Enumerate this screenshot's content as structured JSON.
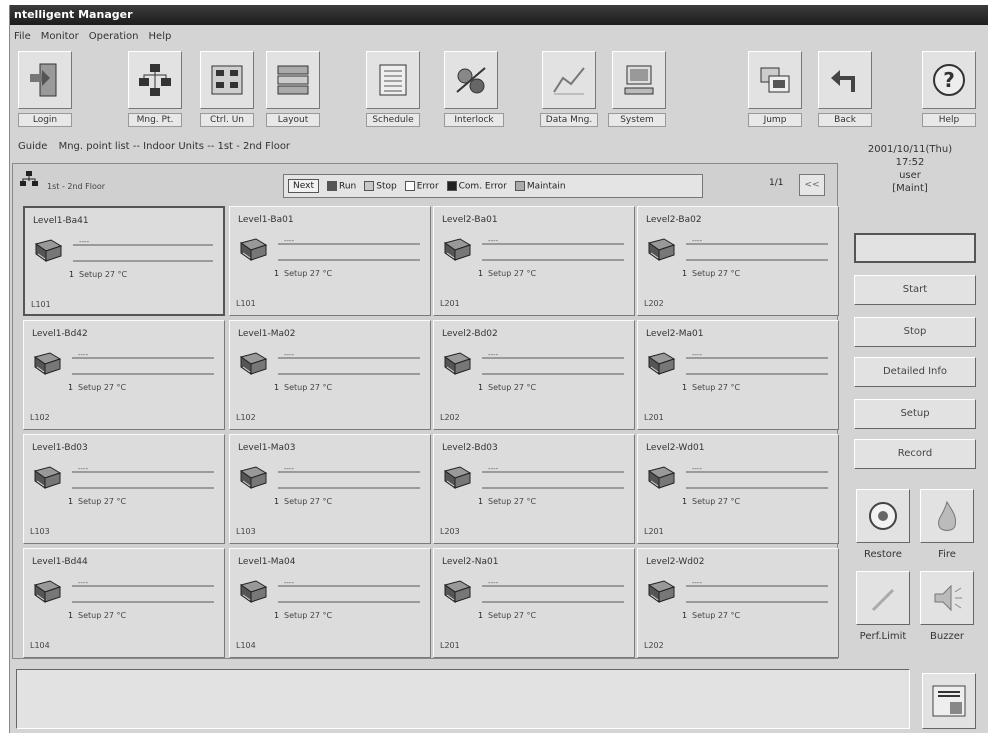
{
  "window": {
    "title": "ntelligent Manager"
  },
  "menu": [
    "File",
    "Monitor",
    "Operation",
    "Help"
  ],
  "toolbar": [
    {
      "id": "login",
      "label": "Login",
      "icon": "login-icon"
    },
    {
      "id": "mng_pt",
      "label": "Mng. Pt.",
      "icon": "network-icon"
    },
    {
      "id": "ctrl_unit",
      "label": "Ctrl. Un",
      "icon": "control-unit-icon"
    },
    {
      "id": "layout",
      "label": "Layout",
      "icon": "layout-icon"
    },
    {
      "id": "schedule",
      "label": "Schedule",
      "icon": "schedule-icon"
    },
    {
      "id": "interlock",
      "label": "Interlock",
      "icon": "interlock-icon"
    },
    {
      "id": "data_mng",
      "label": "Data Mng.",
      "icon": "data-graph-icon"
    },
    {
      "id": "system",
      "label": "System",
      "icon": "computer-icon"
    },
    {
      "id": "jump",
      "label": "Jump",
      "icon": "jump-icon"
    },
    {
      "id": "back",
      "label": "Back",
      "icon": "back-arrow-icon"
    },
    {
      "id": "help",
      "label": "Help",
      "icon": "help-icon"
    }
  ],
  "guide": {
    "label": "Guide",
    "path": "Mng. point list -- Indoor Units -- 1st - 2nd Floor"
  },
  "datetime": {
    "date": "2001/10/11(Thu)",
    "time": "17:52",
    "user_label": "user",
    "user": "[Maint]"
  },
  "panel": {
    "floor_name": "1st - 2nd Floor",
    "legend": {
      "next": "Next",
      "items": [
        {
          "label": "Run",
          "color": "#555555"
        },
        {
          "label": "Stop",
          "color": "#c8c8c8"
        },
        {
          "label": "Error",
          "color": "#ffffff"
        },
        {
          "label": "Com. Error",
          "color": "#222222"
        },
        {
          "label": "Maintain",
          "color": "#aaaaaa"
        }
      ]
    },
    "page": "1/1",
    "page_btn": "<<"
  },
  "units": [
    {
      "name": "Level1-Ba41",
      "val": "----",
      "num": "1",
      "setup": "Setup 27 °C",
      "addr": "L101"
    },
    {
      "name": "Level1-Ba01",
      "val": "----",
      "num": "1",
      "setup": "Setup 27 °C",
      "addr": "L101"
    },
    {
      "name": "Level2-Ba01",
      "val": "----",
      "num": "1",
      "setup": "Setup 27 °C",
      "addr": "L201"
    },
    {
      "name": "Level2-Ba02",
      "val": "----",
      "num": "1",
      "setup": "Setup 27 °C",
      "addr": "L202"
    },
    {
      "name": "Level1-Bd42",
      "val": "----",
      "num": "1",
      "setup": "Setup 27 °C",
      "addr": "L102"
    },
    {
      "name": "Level1-Ma02",
      "val": "----",
      "num": "1",
      "setup": "Setup 27 °C",
      "addr": "L102"
    },
    {
      "name": "Level2-Bd02",
      "val": "----",
      "num": "1",
      "setup": "Setup 27 °C",
      "addr": "L202"
    },
    {
      "name": "Level2-Ma01",
      "val": "----",
      "num": "1",
      "setup": "Setup 27 °C",
      "addr": "L201"
    },
    {
      "name": "Level1-Bd03",
      "val": "----",
      "num": "1",
      "setup": "Setup 27 °C",
      "addr": "L103"
    },
    {
      "name": "Level1-Ma03",
      "val": "----",
      "num": "1",
      "setup": "Setup 27 °C",
      "addr": "L103"
    },
    {
      "name": "Level2-Bd03",
      "val": "----",
      "num": "1",
      "setup": "Setup 27 °C",
      "addr": "L203"
    },
    {
      "name": "Level2-Wd01",
      "val": "----",
      "num": "1",
      "setup": "Setup 27 °C",
      "addr": "L201"
    },
    {
      "name": "Level1-Bd44",
      "val": "----",
      "num": "1",
      "setup": "Setup 27 °C",
      "addr": "L104"
    },
    {
      "name": "Level1-Ma04",
      "val": "----",
      "num": "1",
      "setup": "Setup 27 °C",
      "addr": "L104"
    },
    {
      "name": "Level2-Na01",
      "val": "----",
      "num": "1",
      "setup": "Setup 27 °C",
      "addr": "L201"
    },
    {
      "name": "Level2-Wd02",
      "val": "----",
      "num": "1",
      "setup": "Setup 27 °C",
      "addr": "L202"
    }
  ],
  "side": {
    "top_btn": "",
    "start": "Start",
    "stop": "Stop",
    "detailed": "Detailed Info",
    "setup": "Setup",
    "record": "Record",
    "restore": "Restore",
    "fire": "Fire",
    "perf_limit": "Perf.Limit",
    "buzzer": "Buzzer"
  },
  "status": {
    "message": ""
  }
}
